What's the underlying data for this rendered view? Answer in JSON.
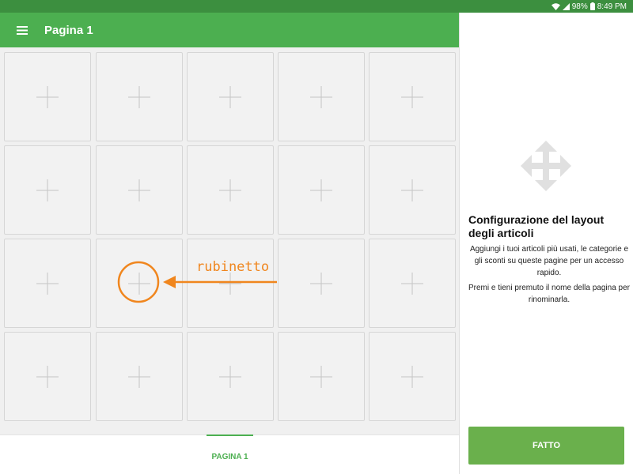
{
  "status_bar": {
    "battery": "98%",
    "time": "8:49 PM",
    "icons": [
      "wifi-icon",
      "signal-icon",
      "battery-icon"
    ]
  },
  "toolbar": {
    "menu_icon": "hamburger-menu-icon",
    "title": "Pagina 1"
  },
  "grid": {
    "rows": 4,
    "columns": 5,
    "tile_icon": "plus-icon"
  },
  "page_tabs": [
    {
      "label": "PAGINA 1",
      "selected": true
    }
  ],
  "side_panel": {
    "icon": "move-arrows-icon",
    "heading": "Configurazione del layout degli articoli",
    "paragraphs": [
      "Aggiungi i tuoi articoli più usati, le categorie e gli sconti su queste pagine per un accesso rapido.",
      "Premi e tieni premuto il nome della pagina per rinominarla."
    ],
    "done_button": "FATTO"
  },
  "annotation": {
    "label": "rubinetto",
    "target_tile": {
      "row": 3,
      "column": 2
    },
    "color": "#f0861e"
  },
  "colors": {
    "status_bar": "#3c8f3f",
    "toolbar": "#4caf50",
    "done_button": "#6ab04c",
    "accent": "#4caf50"
  }
}
